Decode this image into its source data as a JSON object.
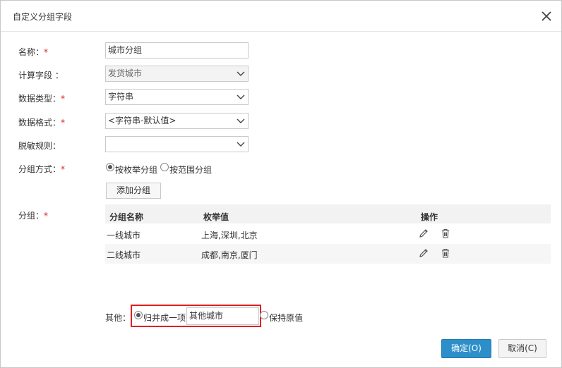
{
  "dialog": {
    "title": "自定义分组字段",
    "close_icon": "close-icon"
  },
  "form": {
    "name": {
      "label": "名称：",
      "required": "*",
      "value": "城市分组"
    },
    "calc_field": {
      "label": "计算字段 ：",
      "value": "发货城市"
    },
    "data_type": {
      "label": "数据类型：",
      "required": "*",
      "value": "字符串"
    },
    "data_format": {
      "label": "数据格式：",
      "required": "*",
      "value": "<字符串-默认值>"
    },
    "mask_rule": {
      "label": "脱敏规则：",
      "value": ""
    },
    "group_method": {
      "label": "分组方式：",
      "required": "*",
      "options": [
        "按枚举分组",
        "按范围分组"
      ],
      "selected": "按枚举分组"
    },
    "add_group_label": "添加分组",
    "group": {
      "label": "分组：",
      "required": "*"
    }
  },
  "group_table": {
    "headers": {
      "name": "分组名称",
      "values": "枚举值",
      "ops": "操作"
    },
    "rows": [
      {
        "name": "一线城市",
        "values": "上海,深圳,北京"
      },
      {
        "name": "二线城市",
        "values": "成都,南京,厦门"
      }
    ],
    "edit_icon": "pencil-icon",
    "delete_icon": "trash-icon"
  },
  "other": {
    "label": "其他：",
    "merge_option": "归并成一项",
    "merge_value": "其他城市",
    "keep_option": "保持原值",
    "selected": "归并成一项"
  },
  "footer": {
    "ok_label": "确定(O)",
    "cancel_label": "取消(C)"
  },
  "colors": {
    "primary": "#2d8fc9",
    "required": "#e02020",
    "highlight_border": "#e02020"
  }
}
